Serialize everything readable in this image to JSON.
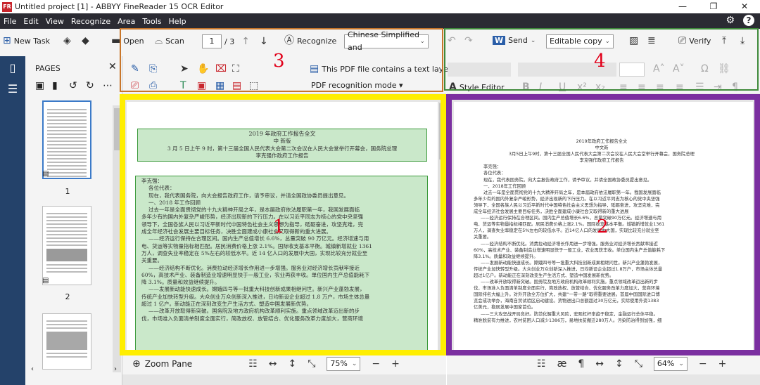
{
  "titlebar": {
    "title": "Untitled project [1] - ABBYY FineReader 15 OCR Editor",
    "min": "—",
    "max": "❐",
    "close": "✕"
  },
  "menu": [
    "File",
    "Edit",
    "View",
    "Recognize",
    "Area",
    "Tools",
    "Help"
  ],
  "menu_right": {
    "settings": "⚙",
    "help": "?"
  },
  "toolbar": {
    "new_task": "New Task",
    "open": "Open",
    "scan": "Scan",
    "page_current": "1",
    "page_total": "/ 3",
    "recognize": "Recognize",
    "language": "Chinese Simplified and",
    "pdf_text_layer": "This PDF file contains a text layer",
    "pdf_mode": "PDF recognition mode ▾",
    "send": "Send",
    "editable": "Editable copy",
    "verify": "Verify",
    "style_editor": "Style Editor"
  },
  "pages_panel": {
    "title": "PAGES",
    "thumbs": [
      "1",
      "2"
    ]
  },
  "annotations": {
    "n1": "1",
    "n2": "2",
    "n3": "3",
    "n4": "4"
  },
  "colors": {
    "yellow": "#ffee00",
    "purple": "#7b2fa0",
    "orange": "#c8762a",
    "green": "#3f8a3b",
    "red": "#e1001a"
  },
  "image_pane": {
    "zoom_label": "Zoom Pane",
    "zoom": "75%",
    "minus": "−",
    "plus": "+"
  },
  "text_pane": {
    "zoom": "64%",
    "minus": "−",
    "plus": "+"
  },
  "doc": {
    "title_zone": [
      "2019 年政府工作报告全文",
      "中 新版",
      "3 月 5 日上午 9 时，第十三届全国人民代表大会第二次会议在人民大会堂举行开幕会，国务院总理",
      "李克强作政府工作报告"
    ],
    "body_zone": [
      "李克强：",
      "各位代表：",
      "现在，我代表国务院，向大会报告政府工作，请予审议，并请全国政协委员提出意见。",
      "一、2018 年工作回顾",
      "过去一年是全面贯彻党的十九大精神开局之年，是本届政府依法履职第一年，我国发展面临",
      "多年少有的国内外复杂严峻形势，经济出现新的下行压力。在以习近平同志为核心的党中央坚强",
      "领导下，全国各族人民以习近平新时代中国特色社会主义思想为指导，砥砺奋进，攻坚克难，完",
      "成全年经济社会发展主要目标任务，决胜全面建成小康社会又取得新的重大进展。",
      "——经济运行保持在合理区间。国内生产总值增长 6.6%，总量突破 90 万亿元。经济增速与用",
      "电、货运等实物量指标相匹配。居民消费价格上涨 2.1%。国际收支基本平衡。城镇新增就业 1361",
      "万人，调查失业率稳定在 5%左右的较低水平。近 14 亿人口的发展中大国，实现比较充分就业至",
      "关重要。",
      "——经济结构不断优化。消费拉动经济增长作用进一步增强。服务业对经济增长贡献率接近",
      "60%，高技术产业、装备制造业增速明显快于一般工业，农业再获丰收。单位国内生产总值能耗下",
      "降 3.1%。质量和效益继续提升。",
      "——发展新动能快速成长。嫦娥四号等一批重大科技创新成果相继问世。新兴产业蓬勃发展，",
      "传统产业加快转型升级。大众创业万众创新深入推进，日均新设企业超过 1.8 万户，市场主体总量",
      "超过 1 亿户。新动能正在深刻改变生产生活方式、塑造中国发展新优势。",
      "——改革开放取得新突破。国务院及地方政府机构改革顺利实施。重点领域改革迈出新的步",
      "伐，市场准入负面清单制度全面实行，简政放权、放管结合、优化服务改革力度加大，营商环境"
    ],
    "text_lines": [
      "2019年政府工作报告全文",
      "中文新",
      "3月5日上午9时，第十三届全国人民代表大会第二次会议在人民大会堂举行开幕会，国务院总理",
      "李克强作政府工作报告",
      "",
      "李克强：",
      "各位代表：",
      "现在，我代表国务院，向大会报告政府工作，请予审议，并请全国政协委员提出意见。",
      "一、2018年工作回顾",
      "过去一年是全面贯彻党的十九大精神开局之年，是本届政府依法履职第一年。我国发展面临",
      "多年少有的国内外复杂严峻形势，经济出现新的下行压力。在以习近平同志为核心的党中央坚强",
      "领导下，全国各族人民以习近平新时代中国特色社会主义思想为指导，砥砺奋进，攻坚克难，完",
      "成全年经济社会发展主要目标任务，决胜全面建成小康社会又取得新的重大进展",
      "——经济运行保持在合理区间。国内生产总值增长6.6%，总量突破90万亿元。经济增速与用",
      "电、货运等实物量指标相匹配。居民消费价格上涨2.1%。国际收支基本平衡。城镇新增就业1361",
      "万人，调查失业率稳定在5%左右的较低水平。近14亿人口的发展中大国，实现比较充分就业至",
      "关重要。",
      "——经济结构不断优化。消费拉动经济增长作用进一步增强。服务业对经济增长贡献率接近",
      "60%，高技术产业、装备制造业增速明显快于一般工业，农业再获丰收。单位国内生产总值能耗下",
      "降3.1%。质量和效益继续提升。",
      "——发展新动能快速成长。嫦娥四号等一批重大科技创新成果相继问世。新兴产业蓬勃发展，",
      "传统产业加快转型升级。大众创业万众创新深入推进，日均新设企业超过1.8万户，市场主体总量",
      "超过1亿户。新动能正在深刻改变生产生活方式、塑造中国发展新优势。",
      "——改革开放取得新突破。国务院及地方政府机构改革顺利实施。重点领域改革迈出新的步",
      "伐，市场准入负面清单制度全面实行，简政放权、放管结合、优化服务改革力度加大，营商环境",
      "国际排名大幅上升。对外开放全方位扩大，共建“一带一路”取得重要进展。首届中国国际进口博",
      "览会成功举办，海南自贸试验区启动建设。货物进出口总额超过30万亿元，实际使用外资1383",
      "亿美元，稳居发展中国家首位。",
      "——三大攻坚战开局良好。防范化解重大风险，宏观杠杆率趋于稳定，金融运行总体平稳。",
      "精准脱贫有力推进，农村贫困人口减少1386万，易地扶贫搬迁280万人。污染防治得到加强，细"
    ]
  }
}
